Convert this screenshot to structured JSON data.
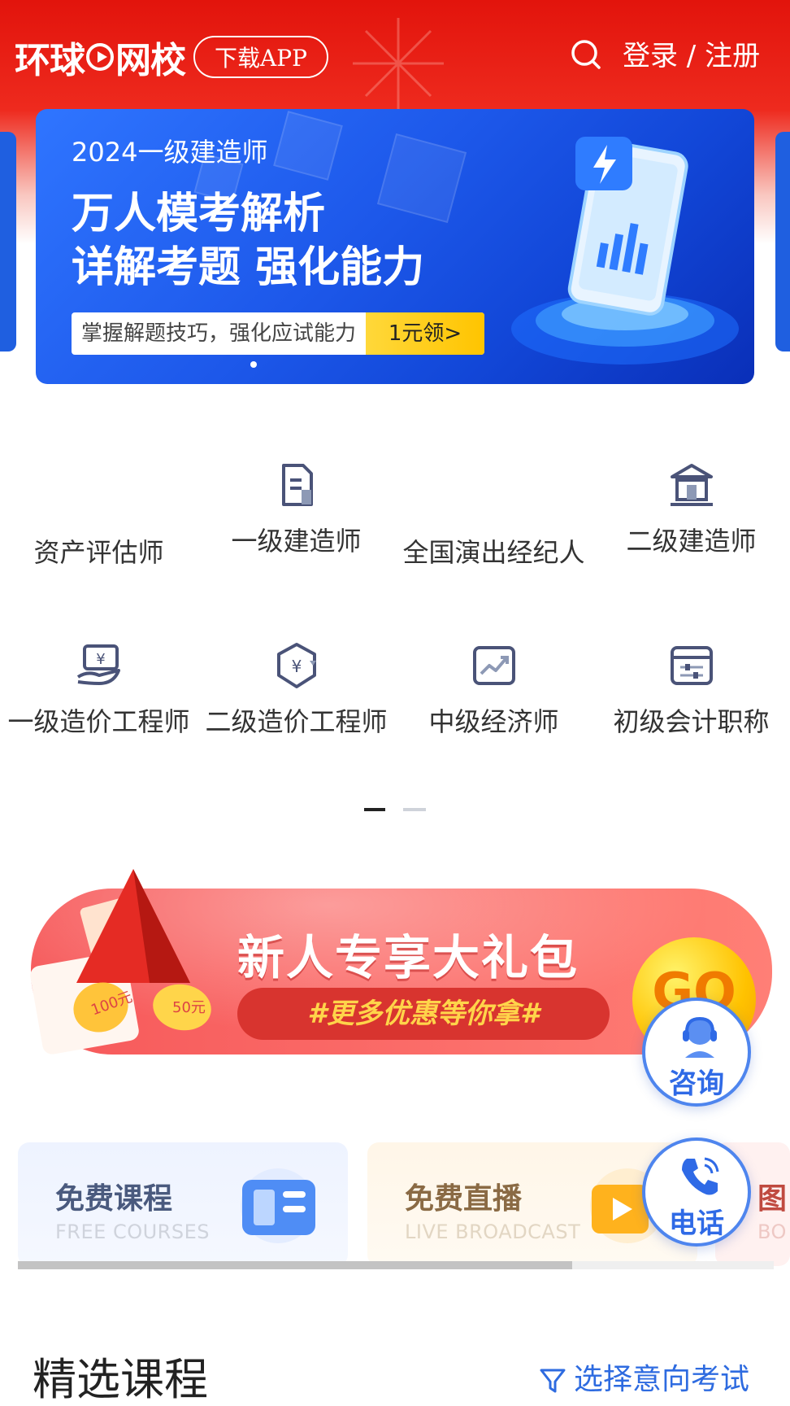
{
  "header": {
    "logo_text_left": "环球",
    "logo_text_right": "网校",
    "download_label": "下载APP",
    "login_label": "登录 / 注册"
  },
  "banner": {
    "year_line": "2024一级建造师",
    "title_line1": "万人模考解析",
    "title_line2": "详解考题 强化能力",
    "pill_text": "掌握解题技巧，强化应试能力",
    "pill_button": "1元领>"
  },
  "categories": {
    "row1": [
      {
        "label": "资产评估师",
        "icon": ""
      },
      {
        "label": "一级建造师",
        "icon": "document-icon"
      },
      {
        "label": "全国演出经纪人",
        "icon": ""
      },
      {
        "label": "二级建造师",
        "icon": "bank-icon"
      }
    ],
    "row2": [
      {
        "label": "一级造价工程师",
        "icon": "money-hand-icon"
      },
      {
        "label": "二级造价工程师",
        "icon": "yuan-hexagon-icon"
      },
      {
        "label": "中级经济师",
        "icon": "trend-chart-icon"
      },
      {
        "label": "初级会计职称",
        "icon": "card-settings-icon"
      }
    ]
  },
  "promo": {
    "title": "新人专享大礼包",
    "subtitle": "#更多优惠等你拿#",
    "go_label": "GO",
    "coupon_100": "100元",
    "coupon_50": "50元"
  },
  "floating": {
    "consult_label": "咨询",
    "phone_label": "电话"
  },
  "free_cards": [
    {
      "title": "免费课程",
      "subtitle": "FREE COURSES",
      "icon": "book-icon"
    },
    {
      "title": "免费直播",
      "subtitle": "LIVE BROADCAST",
      "icon": "play-icon"
    },
    {
      "title": "图",
      "subtitle": "BO"
    }
  ],
  "section": {
    "title": "精选课程",
    "filter_label": "选择意向考试"
  },
  "colors": {
    "brand_red": "#e2140c",
    "accent_blue": "#2e6be0",
    "promo_red": "#f6595a"
  }
}
